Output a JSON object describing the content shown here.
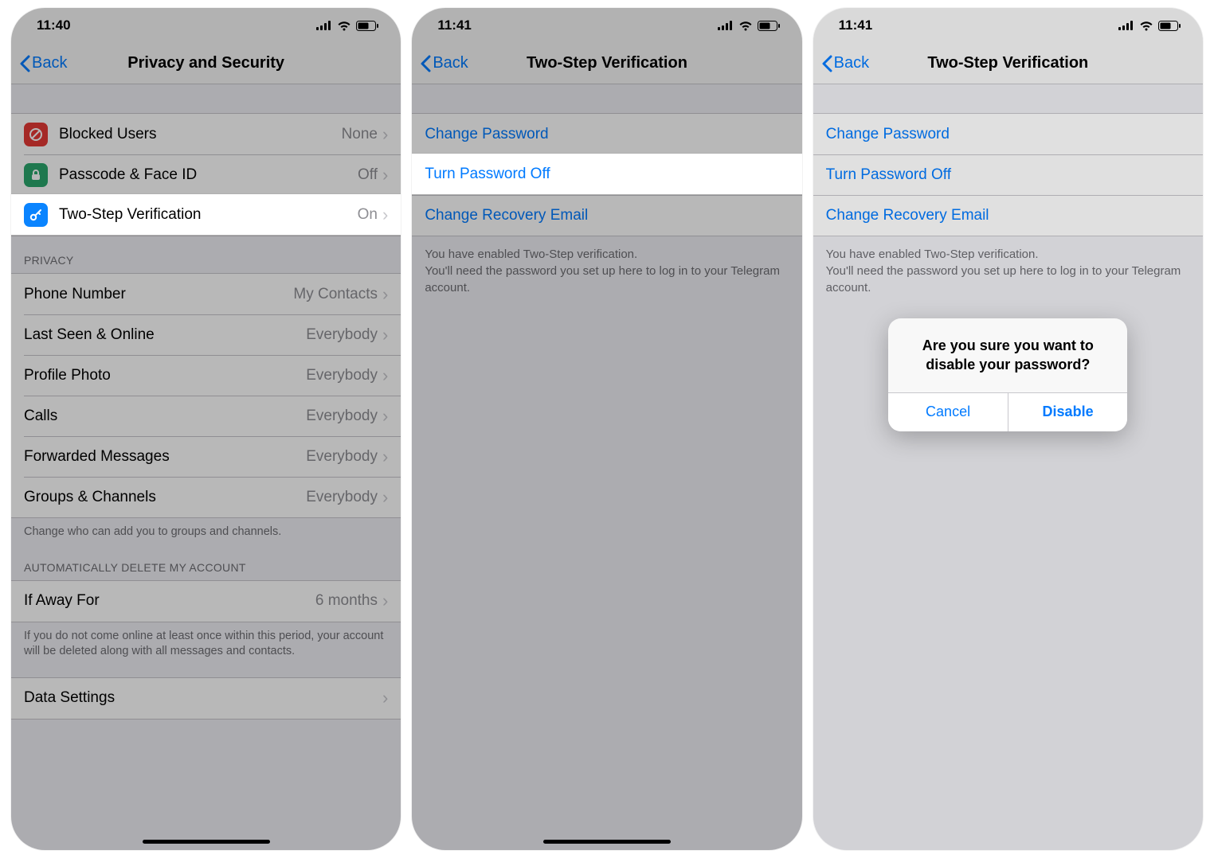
{
  "screen1": {
    "time": "11:40",
    "back": "Back",
    "title": "Privacy and Security",
    "security": {
      "blocked": {
        "label": "Blocked Users",
        "value": "None"
      },
      "passcode": {
        "label": "Passcode & Face ID",
        "value": "Off"
      },
      "twostep": {
        "label": "Two-Step Verification",
        "value": "On"
      }
    },
    "privacy_header": "PRIVACY",
    "privacy": {
      "phone": {
        "label": "Phone Number",
        "value": "My Contacts"
      },
      "lastseen": {
        "label": "Last Seen & Online",
        "value": "Everybody"
      },
      "photo": {
        "label": "Profile Photo",
        "value": "Everybody"
      },
      "calls": {
        "label": "Calls",
        "value": "Everybody"
      },
      "fwd": {
        "label": "Forwarded Messages",
        "value": "Everybody"
      },
      "groups": {
        "label": "Groups & Channels",
        "value": "Everybody"
      }
    },
    "privacy_footer": "Change who can add you to groups and channels.",
    "delete_header": "AUTOMATICALLY DELETE MY ACCOUNT",
    "delete_row": {
      "label": "If Away For",
      "value": "6 months"
    },
    "delete_footer": "If you do not come online at least once within this period, your account will be deleted along with all messages and contacts.",
    "data_settings": "Data Settings"
  },
  "screen2": {
    "time": "11:41",
    "back": "Back",
    "title": "Two-Step Verification",
    "change_pw": "Change Password",
    "turn_off": "Turn Password Off",
    "recovery": "Change Recovery Email",
    "footer": "You have enabled Two-Step verification.\nYou'll need the password you set up here to log in to your Telegram account."
  },
  "screen3": {
    "time": "11:41",
    "back": "Back",
    "title": "Two-Step Verification",
    "change_pw": "Change Password",
    "turn_off": "Turn Password Off",
    "recovery": "Change Recovery Email",
    "footer": "You have enabled Two-Step verification.\nYou'll need the password you set up here to log in to your Telegram account.",
    "alert": {
      "title": "Are you sure you want to disable your password?",
      "cancel": "Cancel",
      "disable": "Disable"
    }
  },
  "icons": {
    "blocked_color": "#e53935",
    "passcode_color": "#2aa76d",
    "key_color": "#0a84ff"
  }
}
